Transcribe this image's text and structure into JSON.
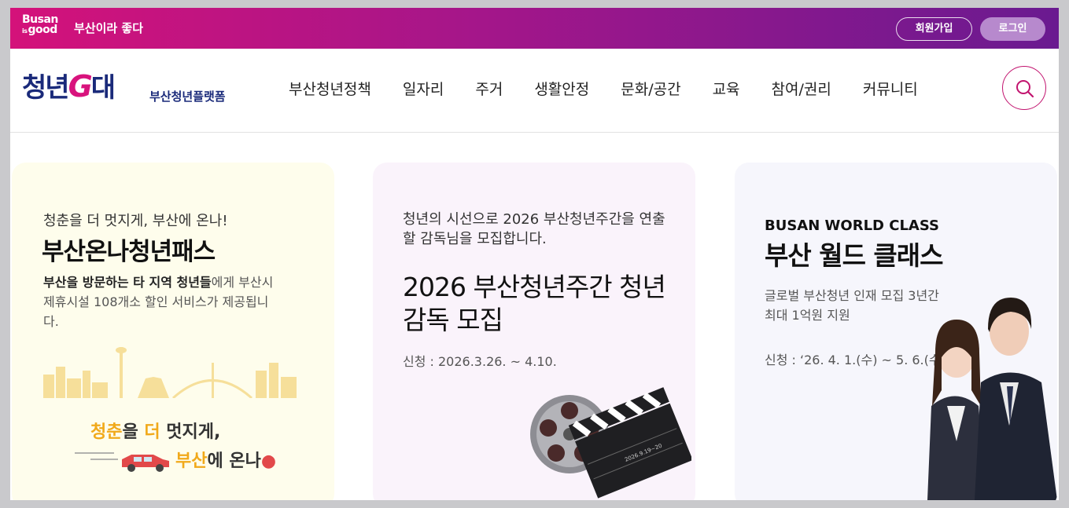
{
  "topbar": {
    "logo_line1": "Busan",
    "logo_is": "is",
    "logo_line2": "good",
    "slogan": "부산이라 좋다",
    "join_label": "회원가입",
    "login_label": "로그인"
  },
  "header": {
    "logo_text_a": "청년",
    "logo_text_g": "G",
    "logo_text_b": "대",
    "logo_subtitle": "부산청년플랫폼",
    "nav": [
      "부산청년정책",
      "일자리",
      "주거",
      "생활안정",
      "문화/공간",
      "교육",
      "참여/권리",
      "커뮤니티"
    ]
  },
  "cards": [
    {
      "kicker": "청춘을 더 멋지게, 부산에 온나!",
      "title": "부산온나청년패스",
      "desc_bold": "부산을 방문하는 타 지역 청년들",
      "desc_rest": "에게 부산시 제휴시설 108개소 할인 서비스가 제공됩니다.",
      "deco_line1_a": "청춘",
      "deco_line1_b": "을 ",
      "deco_line1_c": "더",
      "deco_line1_d": " 멋지게,",
      "deco_line2_a": "부산",
      "deco_line2_b": "에 온나"
    },
    {
      "kicker": "청년의 시선으로 2026 부산청년주간을 연출할 감독님을 모집합니다.",
      "title": "2026 부산청년주간 청년감독 모집",
      "date": "신청 : 2026.3.26. ~ 4.10.",
      "clapper_text": "2026.9.19~20"
    },
    {
      "kicker": "BUSAN WORLD CLASS",
      "title": "부산 월드 클래스",
      "desc": "글로벌 부산청년 인재 모집 3년간 최대 1억원 지원",
      "date": "신청 : ‘26. 4. 1.(수) ~ 5. 6.(수)"
    }
  ],
  "colors": {
    "brand_pink": "#d4127a",
    "brand_purple": "#6a1a90",
    "navy": "#1a2a7a"
  }
}
